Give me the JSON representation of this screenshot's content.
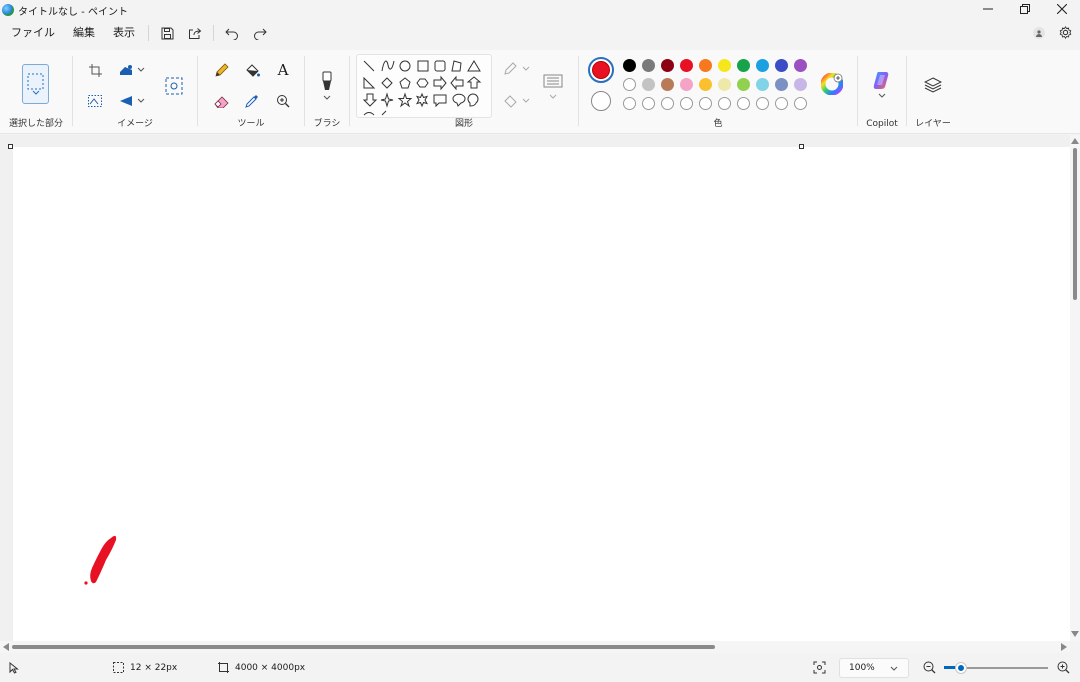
{
  "window": {
    "title": "タイトルなし - ペイント",
    "controls": [
      "minimize-icon",
      "restore-icon",
      "close-icon"
    ]
  },
  "menu": {
    "file": "ファイル",
    "edit": "編集",
    "view": "表示"
  },
  "ribbon": {
    "groups": {
      "selection": "選択した部分",
      "image": "イメージ",
      "tools": "ツール",
      "brush": "ブラシ",
      "shapes": "図形",
      "colors": "色",
      "copilot": "Copilot",
      "layers": "レイヤー"
    },
    "tools": {
      "text_tool": "A"
    },
    "colors": {
      "primary": "#e81123",
      "secondary": "#ffffff",
      "palette_row1": [
        "#000000",
        "#7a7a7a",
        "#8b0012",
        "#e81123",
        "#f7781e",
        "#f6e71d",
        "#16a34a",
        "#1ba1e2",
        "#3c4cc4",
        "#9c4fc0"
      ],
      "palette_row2": [
        "#ffffff",
        "#c3c3c3",
        "#b97a57",
        "#f5a3c7",
        "#fbc02d",
        "#eee8aa",
        "#92d050",
        "#80d4e6",
        "#7b91c4",
        "#c8b7e6"
      ]
    }
  },
  "canvas": {
    "background": "#ffffff"
  },
  "status": {
    "selection_size": "12 × 22px",
    "canvas_size": "4000 × 4000px",
    "zoom": "100%"
  }
}
